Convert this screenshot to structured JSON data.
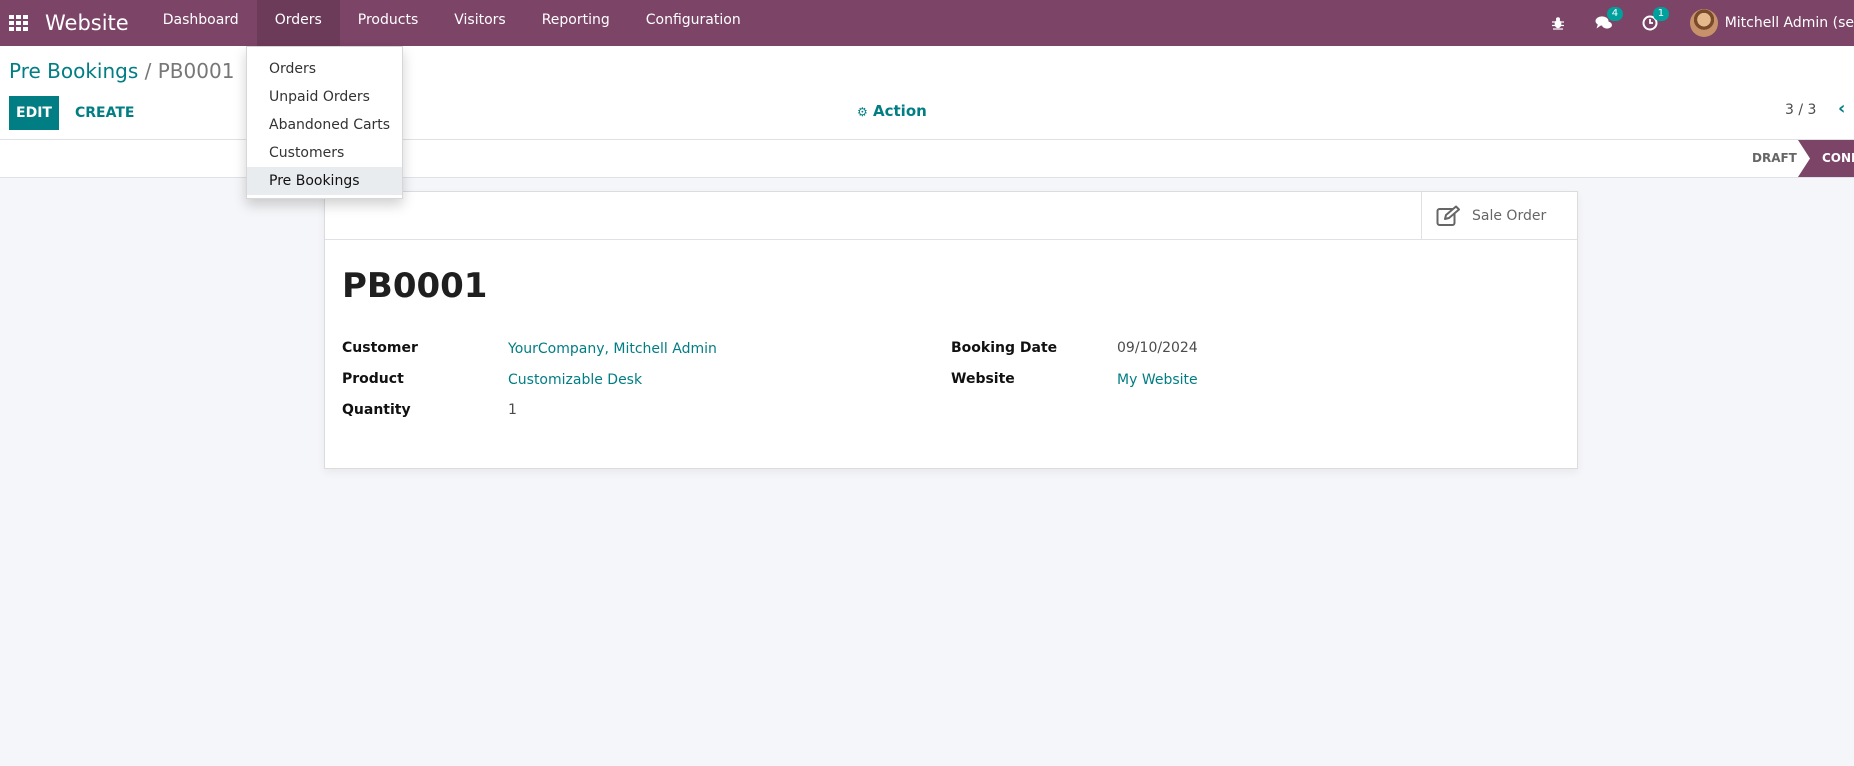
{
  "navbar": {
    "brand": "Website",
    "menu": [
      {
        "label": "Dashboard"
      },
      {
        "label": "Orders"
      },
      {
        "label": "Products"
      },
      {
        "label": "Visitors"
      },
      {
        "label": "Reporting"
      },
      {
        "label": "Configuration"
      }
    ],
    "messages_badge": "4",
    "activities_badge": "1",
    "user_name": "Mitchell Admin (se"
  },
  "dropdown": {
    "items": [
      {
        "label": "Orders"
      },
      {
        "label": "Unpaid Orders"
      },
      {
        "label": "Abandoned Carts"
      },
      {
        "label": "Customers"
      },
      {
        "label": "Pre Bookings"
      }
    ]
  },
  "control": {
    "breadcrumb_parent": "Pre Bookings",
    "breadcrumb_sep": " / ",
    "breadcrumb_current": "PB0001",
    "edit_label": "EDIT",
    "create_label": "CREATE",
    "action_label": "Action",
    "pager": "3 / 3"
  },
  "status": {
    "draft": "DRAFT",
    "confirmed": "CONFIRMED"
  },
  "sheet": {
    "smart_button": "Sale Order",
    "title": "PB0001",
    "fields": {
      "customer_label": "Customer",
      "customer_value": "YourCompany, Mitchell Admin",
      "product_label": "Product",
      "product_value": "Customizable Desk",
      "quantity_label": "Quantity",
      "quantity_value": "1",
      "booking_date_label": "Booking Date",
      "booking_date_value": "09/10/2024",
      "website_label": "Website",
      "website_value": "My Website"
    }
  },
  "colors": {
    "brand": "#7c4467",
    "accent": "#017e84",
    "badge": "#00a09d"
  }
}
